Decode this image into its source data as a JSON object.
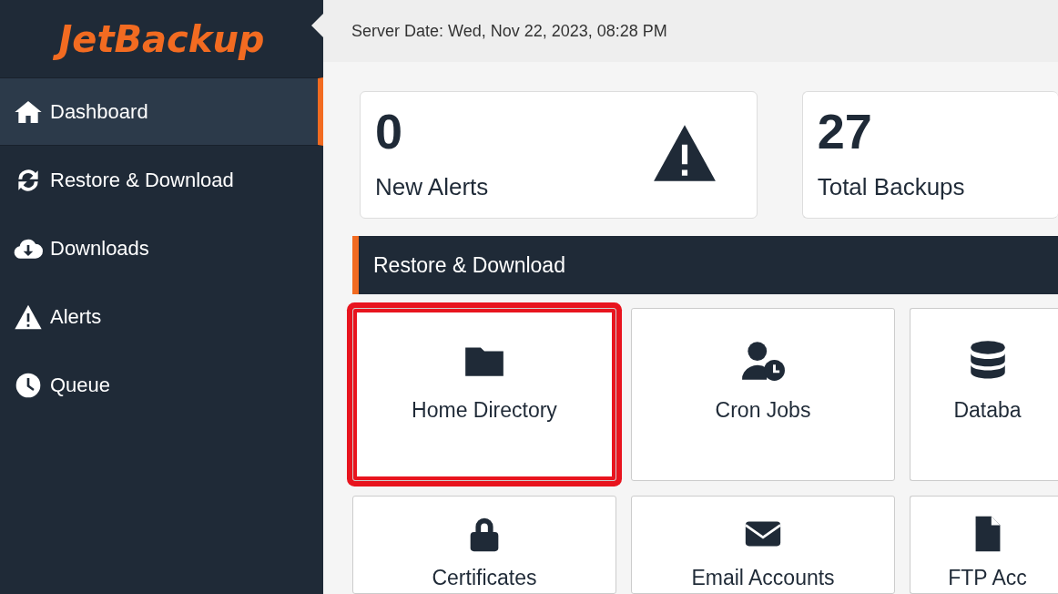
{
  "logo": {
    "text": "JetBackup"
  },
  "header": {
    "server_date": "Server Date: Wed, Nov 22, 2023, 08:28 PM"
  },
  "sidebar": {
    "items": [
      {
        "label": "Dashboard",
        "selected": true
      },
      {
        "label": "Restore & Download",
        "selected": false
      },
      {
        "label": "Downloads",
        "selected": false
      },
      {
        "label": "Alerts",
        "selected": false
      },
      {
        "label": "Queue",
        "selected": false
      }
    ]
  },
  "stats": [
    {
      "value": "0",
      "label": "New Alerts"
    },
    {
      "value": "27",
      "label": "Total Backups"
    }
  ],
  "section": {
    "title": "Restore & Download"
  },
  "tiles": [
    {
      "label": "Home Directory",
      "highlighted": true
    },
    {
      "label": "Cron Jobs",
      "highlighted": false
    },
    {
      "label": "Databa",
      "highlighted": false
    },
    {
      "label": "Certificates",
      "highlighted": false
    },
    {
      "label": "Email Accounts",
      "highlighted": false
    },
    {
      "label": "FTP Acc",
      "highlighted": false
    }
  ]
}
